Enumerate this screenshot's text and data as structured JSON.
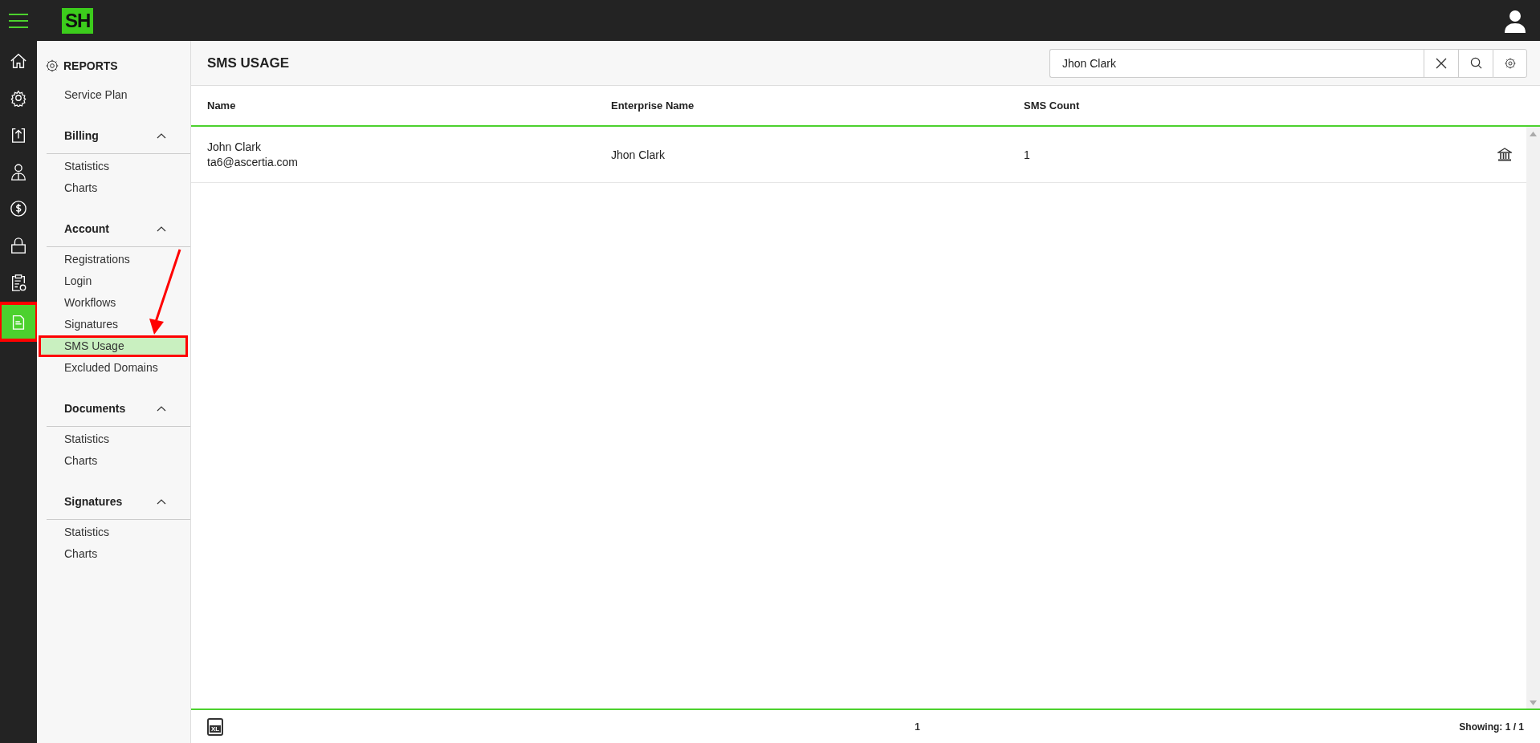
{
  "app": {
    "logo": "SH"
  },
  "rail": [
    {
      "kind": "home",
      "selected": false
    },
    {
      "kind": "gear",
      "selected": false
    },
    {
      "kind": "upload",
      "selected": false
    },
    {
      "kind": "person",
      "selected": false
    },
    {
      "kind": "dollar",
      "selected": false
    },
    {
      "kind": "lock",
      "selected": false
    },
    {
      "kind": "clipboard",
      "selected": false
    },
    {
      "kind": "document",
      "selected": true
    }
  ],
  "sidebar": {
    "title": "REPORTS",
    "top_items": [
      {
        "label": "Service Plan",
        "selected": false
      }
    ],
    "sections": [
      {
        "title": "Billing",
        "expanded": true,
        "items": [
          {
            "label": "Statistics",
            "selected": false
          },
          {
            "label": "Charts",
            "selected": false
          }
        ]
      },
      {
        "title": "Account",
        "expanded": true,
        "items": [
          {
            "label": "Registrations",
            "selected": false
          },
          {
            "label": "Login",
            "selected": false
          },
          {
            "label": "Workflows",
            "selected": false
          },
          {
            "label": "Signatures",
            "selected": false
          },
          {
            "label": "SMS Usage",
            "selected": true
          },
          {
            "label": "Excluded Domains",
            "selected": false
          }
        ]
      },
      {
        "title": "Documents",
        "expanded": true,
        "items": [
          {
            "label": "Statistics",
            "selected": false
          },
          {
            "label": "Charts",
            "selected": false
          }
        ]
      },
      {
        "title": "Signatures",
        "expanded": true,
        "items": [
          {
            "label": "Statistics",
            "selected": false
          },
          {
            "label": "Charts",
            "selected": false
          }
        ]
      }
    ]
  },
  "page": {
    "title": "SMS USAGE",
    "search": {
      "value": "Jhon Clark"
    }
  },
  "table": {
    "columns": [
      "Name",
      "Enterprise Name",
      "SMS Count"
    ],
    "rows": [
      {
        "name": "John Clark",
        "email": "ta6@ascertia.com",
        "enterprise": "Jhon Clark",
        "sms_count": "1"
      }
    ]
  },
  "footer": {
    "export_label": "XL",
    "page": "1",
    "showing": "Showing: 1 / 1"
  }
}
